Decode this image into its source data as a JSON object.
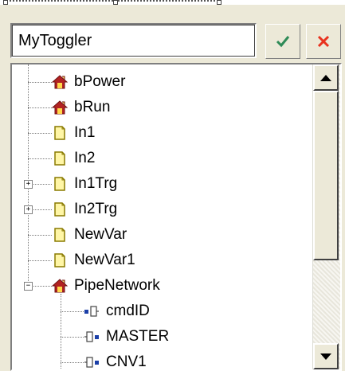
{
  "name_field": {
    "value": "MyToggler"
  },
  "buttons": {
    "ok_icon": "checkmark-icon",
    "cancel_icon": "x-close-icon",
    "ok_color": "#2e8b57",
    "cancel_color": "#e8321e"
  },
  "tree": {
    "items": [
      {
        "label": "bPower",
        "icon": "house-icon"
      },
      {
        "label": "bRun",
        "icon": "house-icon"
      },
      {
        "label": "In1",
        "icon": "variable-icon"
      },
      {
        "label": "In2",
        "icon": "variable-icon"
      },
      {
        "label": "In1Trg",
        "icon": "variable-icon",
        "expander": "+"
      },
      {
        "label": "In2Trg",
        "icon": "variable-icon",
        "expander": "+"
      },
      {
        "label": "NewVar",
        "icon": "variable-icon"
      },
      {
        "label": "NewVar1",
        "icon": "variable-icon"
      },
      {
        "label": "PipeNetwork",
        "icon": "house-icon",
        "expander": "−"
      },
      {
        "label": "cmdID",
        "icon": "input-pin-icon"
      },
      {
        "label": "MASTER",
        "icon": "output-pin-icon"
      },
      {
        "label": "CNV1",
        "icon": "output-pin-icon"
      }
    ]
  },
  "scrollbar": {
    "up_icon": "arrow-up-icon",
    "down_icon": "arrow-down-icon"
  }
}
